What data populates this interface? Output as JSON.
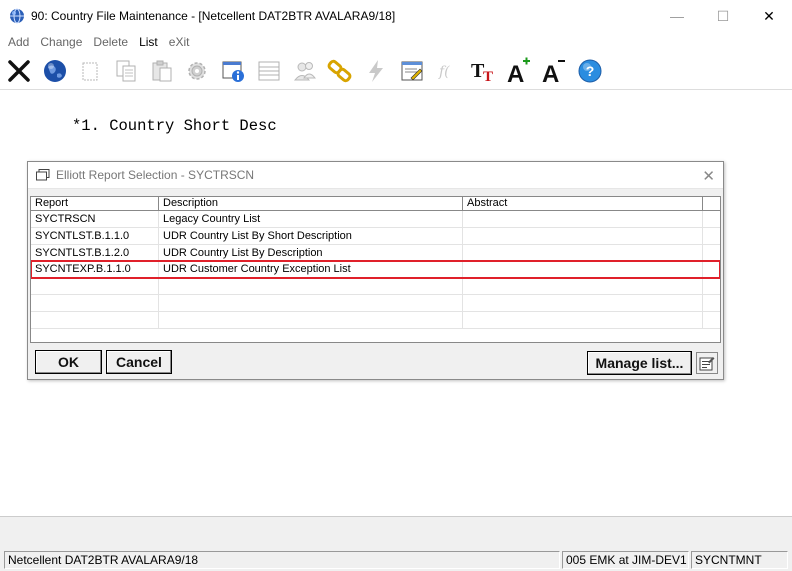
{
  "window": {
    "title": "90: Country File Maintenance - [Netcellent DAT2BTR AVALARA9/18]",
    "minimize": "—",
    "maximize": "☐",
    "close": "✕"
  },
  "menu": {
    "items": [
      {
        "label": "Add",
        "active": false
      },
      {
        "label": "Change",
        "active": false
      },
      {
        "label": "Delete",
        "active": false
      },
      {
        "label": "List",
        "active": true
      },
      {
        "label": "eXit",
        "active": false
      }
    ]
  },
  "toolbar": {
    "buttons": [
      {
        "icon": "close-x-icon",
        "enabled": true
      },
      {
        "icon": "globe-icon",
        "enabled": true
      },
      {
        "icon": "blank-page-icon",
        "enabled": false
      },
      {
        "icon": "copy-icon",
        "enabled": false
      },
      {
        "icon": "paste-icon",
        "enabled": false
      },
      {
        "icon": "gear-icon",
        "enabled": false
      },
      {
        "icon": "info-window-icon",
        "enabled": true
      },
      {
        "icon": "list-icon",
        "enabled": false
      },
      {
        "icon": "users-icon",
        "enabled": false
      },
      {
        "icon": "chain-link-icon",
        "enabled": true
      },
      {
        "icon": "lightning-icon",
        "enabled": false
      },
      {
        "icon": "edit-document-icon",
        "enabled": true
      },
      {
        "icon": "function-icon",
        "enabled": false
      },
      {
        "icon": "font-icon",
        "enabled": true
      },
      {
        "icon": "font-increase-icon",
        "enabled": true
      },
      {
        "icon": "font-decrease-icon",
        "enabled": true
      },
      {
        "icon": "help-icon",
        "enabled": true
      }
    ],
    "font_label": "T",
    "font_label_small": "T",
    "font_increase_label": "A",
    "font_decrease_label": "A",
    "help_label": "?"
  },
  "main": {
    "field_label": "*1. Country Short Desc"
  },
  "dialog": {
    "title": "Elliott Report Selection - SYCTRSCN",
    "close": "✕",
    "columns": [
      "Report",
      "Description",
      "Abstract"
    ],
    "rows": [
      {
        "report": "SYCTRSCN",
        "description": "Legacy Country List",
        "abstract": ""
      },
      {
        "report": "SYCNTLST.B.1.1.0",
        "description": "UDR Country List By Short Description",
        "abstract": ""
      },
      {
        "report": "SYCNTLST.B.1.2.0",
        "description": "UDR Country List By Description",
        "abstract": ""
      },
      {
        "report": "SYCNTEXP.B.1.1.0",
        "description": "UDR Customer Country Exception List",
        "abstract": ""
      },
      {
        "report": "",
        "description": "",
        "abstract": ""
      },
      {
        "report": "",
        "description": "",
        "abstract": ""
      },
      {
        "report": "",
        "description": "",
        "abstract": ""
      }
    ],
    "selected_row": 3,
    "ok_label": "OK",
    "cancel_label": "Cancel",
    "manage_label": "Manage list..."
  },
  "statusbar": {
    "company": "Netcellent DAT2BTR AVALARA9/18",
    "user": "005 EMK at JIM-DEV1",
    "program": "SYCNTMNT"
  },
  "colors": {
    "highlight": "#e0202a",
    "chrome": "#f0f0f0"
  }
}
